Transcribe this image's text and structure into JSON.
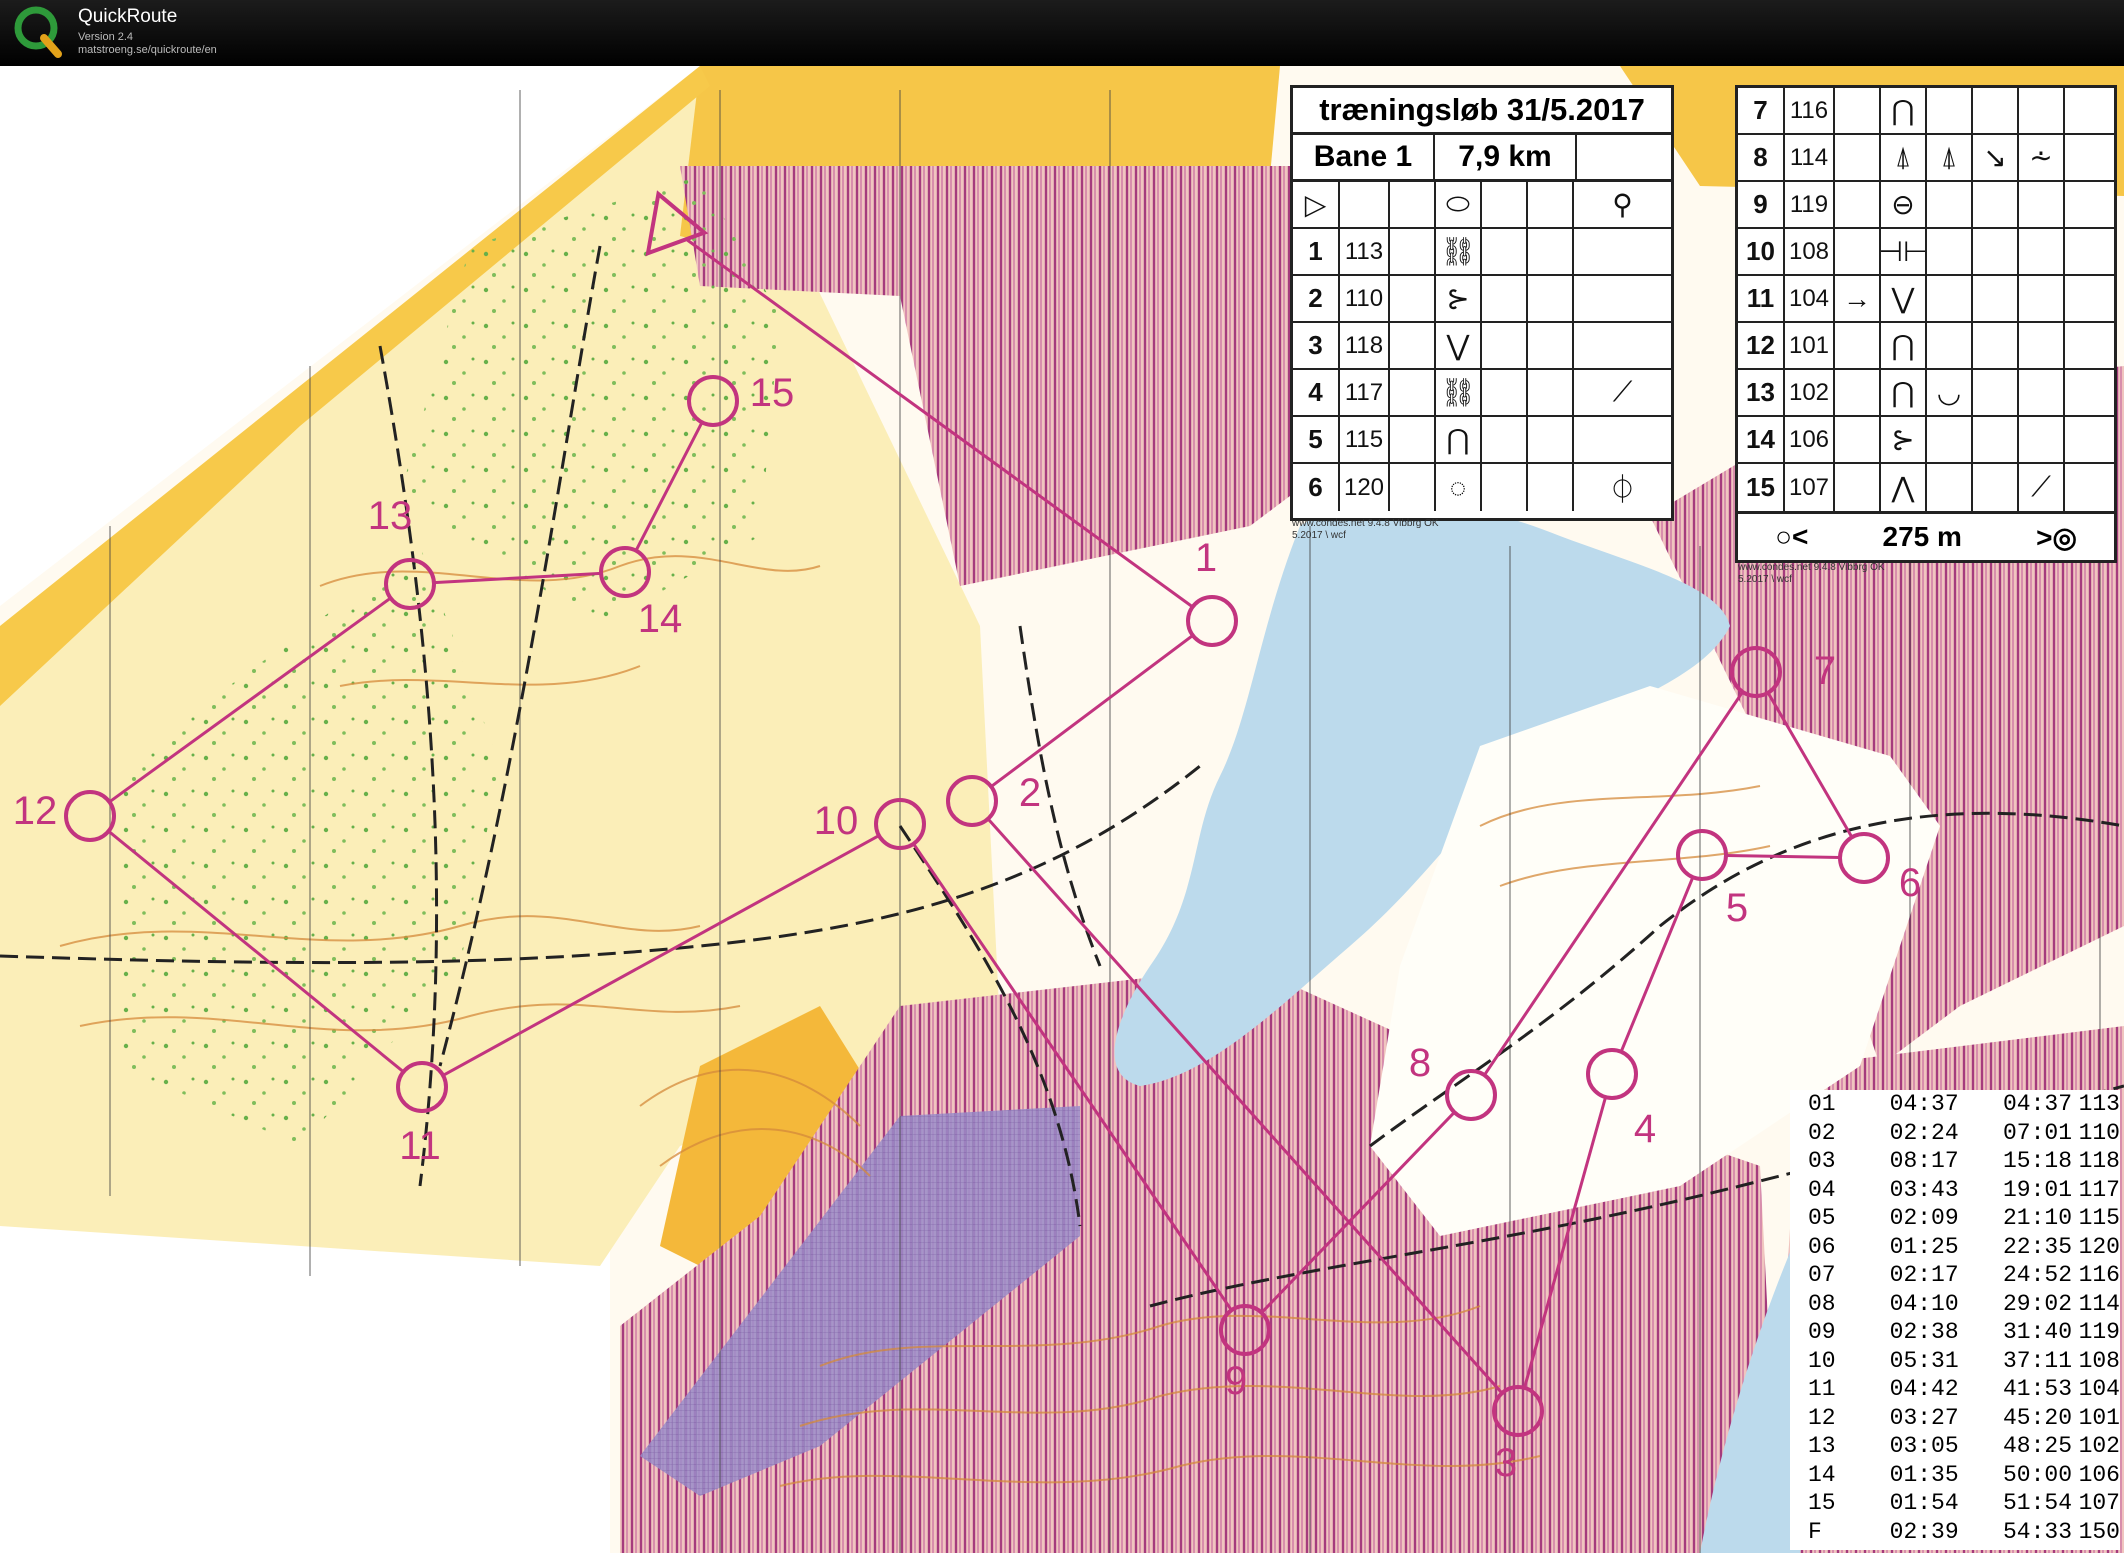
{
  "app": {
    "name": "QuickRoute",
    "version": "Version 2.4",
    "url": "matstroeng.se/quickroute/en"
  },
  "colors": {
    "course": "#c2347f",
    "water": "#bcdaec",
    "open_land": "#f7c94a",
    "rough_open": "#fbe8a8",
    "contour": "#d58a3b",
    "forbidden": "#a53b7d"
  },
  "map": {
    "controls": [
      {
        "label": "1"
      },
      {
        "label": "2"
      },
      {
        "label": "3"
      },
      {
        "label": "4"
      },
      {
        "label": "5"
      },
      {
        "label": "6"
      },
      {
        "label": "7"
      },
      {
        "label": "8"
      },
      {
        "label": "9"
      },
      {
        "label": "10"
      },
      {
        "label": "11"
      },
      {
        "label": "12"
      },
      {
        "label": "13"
      },
      {
        "label": "14"
      },
      {
        "label": "15"
      }
    ]
  },
  "description_card_1": {
    "title": "træningsløb 31/5.2017",
    "course": "Bane 1",
    "length": "7,9 km",
    "start_symbol": "triangle-icon",
    "rows": [
      {
        "num": "1",
        "code": "113"
      },
      {
        "num": "2",
        "code": "110"
      },
      {
        "num": "3",
        "code": "118"
      },
      {
        "num": "4",
        "code": "117"
      },
      {
        "num": "5",
        "code": "115"
      },
      {
        "num": "6",
        "code": "120"
      }
    ],
    "printer_line1": "www.condes.net 9.4.8 Vibbrg OK",
    "printer_line2": "5.2017 \\ wcf"
  },
  "description_card_2": {
    "rows": [
      {
        "num": "7",
        "code": "116"
      },
      {
        "num": "8",
        "code": "114"
      },
      {
        "num": "9",
        "code": "119"
      },
      {
        "num": "10",
        "code": "108"
      },
      {
        "num": "11",
        "code": "104"
      },
      {
        "num": "12",
        "code": "101"
      },
      {
        "num": "13",
        "code": "102"
      },
      {
        "num": "14",
        "code": "106"
      },
      {
        "num": "15",
        "code": "107"
      }
    ],
    "finish_distance": "275 m",
    "printer_line1": "www.condes.net 9.4.8 Vibbrg OK",
    "printer_line2": "5.2017 \\ wcf"
  },
  "splits": [
    {
      "leg": "01",
      "split": "04:37",
      "total": "04:37",
      "code": "113"
    },
    {
      "leg": "02",
      "split": "02:24",
      "total": "07:01",
      "code": "110"
    },
    {
      "leg": "03",
      "split": "08:17",
      "total": "15:18",
      "code": "118"
    },
    {
      "leg": "04",
      "split": "03:43",
      "total": "19:01",
      "code": "117"
    },
    {
      "leg": "05",
      "split": "02:09",
      "total": "21:10",
      "code": "115"
    },
    {
      "leg": "06",
      "split": "01:25",
      "total": "22:35",
      "code": "120"
    },
    {
      "leg": "07",
      "split": "02:17",
      "total": "24:52",
      "code": "116"
    },
    {
      "leg": "08",
      "split": "04:10",
      "total": "29:02",
      "code": "114"
    },
    {
      "leg": "09",
      "split": "02:38",
      "total": "31:40",
      "code": "119"
    },
    {
      "leg": "10",
      "split": "05:31",
      "total": "37:11",
      "code": "108"
    },
    {
      "leg": "11",
      "split": "04:42",
      "total": "41:53",
      "code": "104"
    },
    {
      "leg": "12",
      "split": "03:27",
      "total": "45:20",
      "code": "101"
    },
    {
      "leg": "13",
      "split": "03:05",
      "total": "48:25",
      "code": "102"
    },
    {
      "leg": "14",
      "split": "01:35",
      "total": "50:00",
      "code": "106"
    },
    {
      "leg": "15",
      "split": "01:54",
      "total": "51:54",
      "code": "107"
    },
    {
      "leg": "F",
      "split": "02:39",
      "total": "54:33",
      "code": "150"
    }
  ]
}
